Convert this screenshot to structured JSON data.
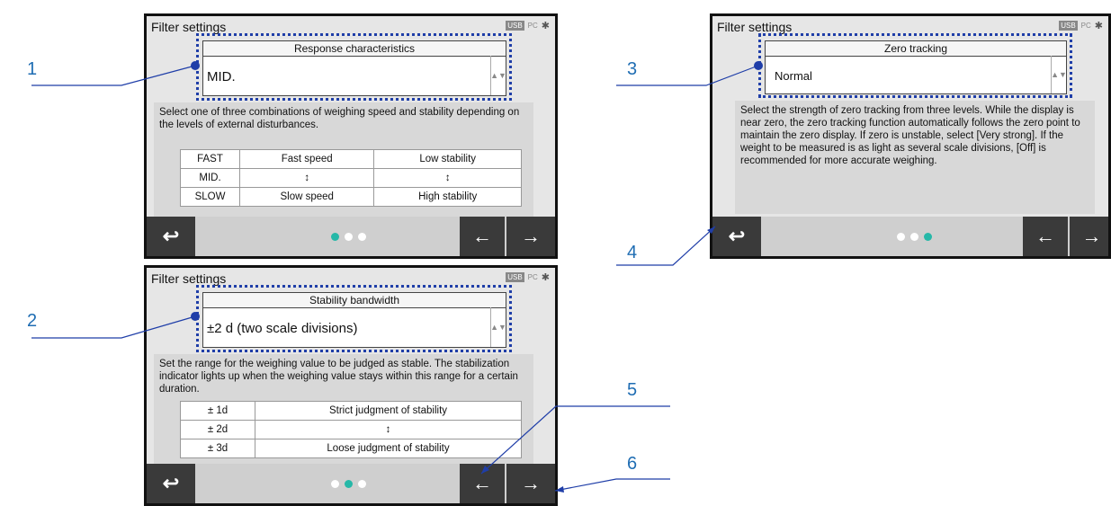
{
  "title": "Filter settings",
  "status": {
    "usb": "USB",
    "pc": "PC",
    "bt": "✱"
  },
  "screen1": {
    "selector_label": "Response characteristics",
    "selector_value": "MID.",
    "description": "Select one of three combinations of weighing speed and stability depending on the levels of external disturbances.",
    "table": [
      [
        "FAST",
        "Fast speed",
        "Low stability"
      ],
      [
        "MID.",
        "↕",
        "↕"
      ],
      [
        "SLOW",
        "Slow speed",
        "High stability"
      ]
    ]
  },
  "screen2": {
    "selector_label": "Stability bandwidth",
    "selector_value": "±2 d (two scale divisions)",
    "description": "Set the range for the weighing value to be judged as stable. The stabilization indicator lights up when the weighing value stays within this range for a certain duration.",
    "table": [
      [
        "± 1d",
        "Strict judgment of stability"
      ],
      [
        "± 2d",
        "↕"
      ],
      [
        "± 3d",
        "Loose judgment of stability"
      ]
    ]
  },
  "screen3": {
    "selector_label": "Zero tracking",
    "selector_value": "Normal",
    "description": "Select the strength of zero tracking from three levels. While the display is near zero, the zero tracking function automatically follows the zero point to maintain the zero display. If zero is unstable, select [Very strong]. If the weight to be measured is as light as several scale divisions, [Off] is recommended for more accurate weighing."
  },
  "buttons": {
    "back": "↩",
    "prev": "←",
    "next": "→"
  },
  "callouts": [
    "1",
    "2",
    "3",
    "4",
    "5",
    "6"
  ],
  "colors": {
    "accent": "#26b8a8",
    "callout": "#1f6db3",
    "dotbox": "#1f3ea8"
  }
}
